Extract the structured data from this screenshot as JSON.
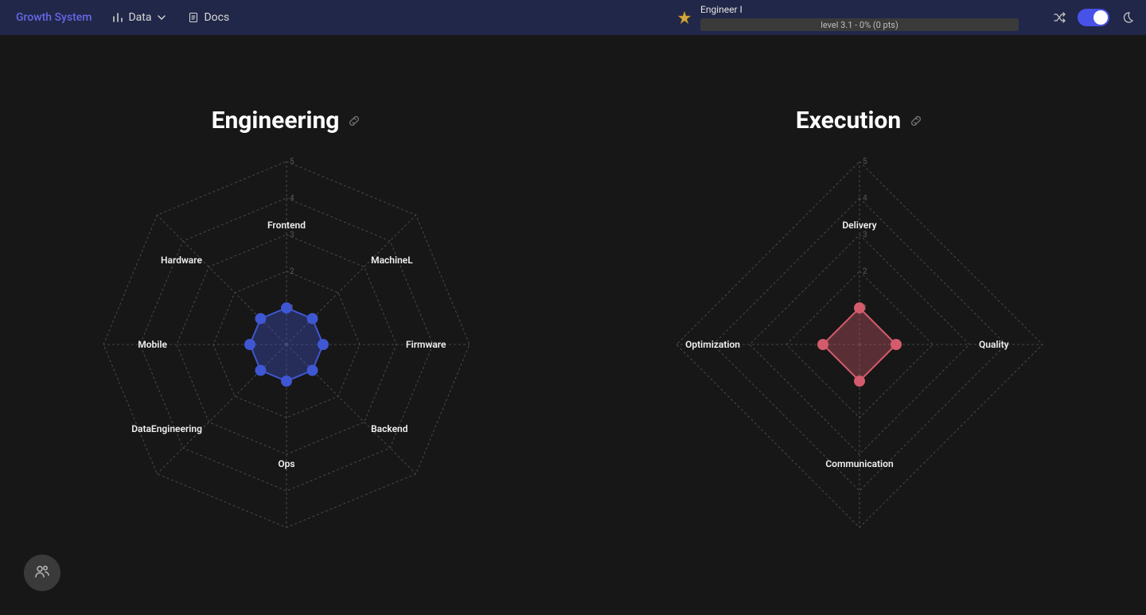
{
  "brand": "Growth System",
  "nav": {
    "data_label": "Data",
    "docs_label": "Docs"
  },
  "level": {
    "role": "Engineer I",
    "progress_text": "level 3.1 - 0% (0 pts)"
  },
  "chart_data": [
    {
      "type": "radar",
      "title": "Engineering",
      "max": 5,
      "color": "#3f57d2",
      "axes": [
        "Frontend",
        "MachineL",
        "Firmware",
        "Backend",
        "Ops",
        "DataEngineering",
        "Mobile",
        "Hardware"
      ],
      "values": [
        1,
        1,
        1,
        1,
        1,
        1,
        1,
        1
      ],
      "ticks": [
        1,
        2,
        3,
        4,
        5
      ]
    },
    {
      "type": "radar",
      "title": "Execution",
      "max": 5,
      "color": "#d45b6c",
      "axes": [
        "Delivery",
        "Quality",
        "Communication",
        "Optimization"
      ],
      "values": [
        1,
        1,
        1,
        1
      ],
      "ticks": [
        1,
        2,
        3,
        4,
        5
      ]
    }
  ]
}
